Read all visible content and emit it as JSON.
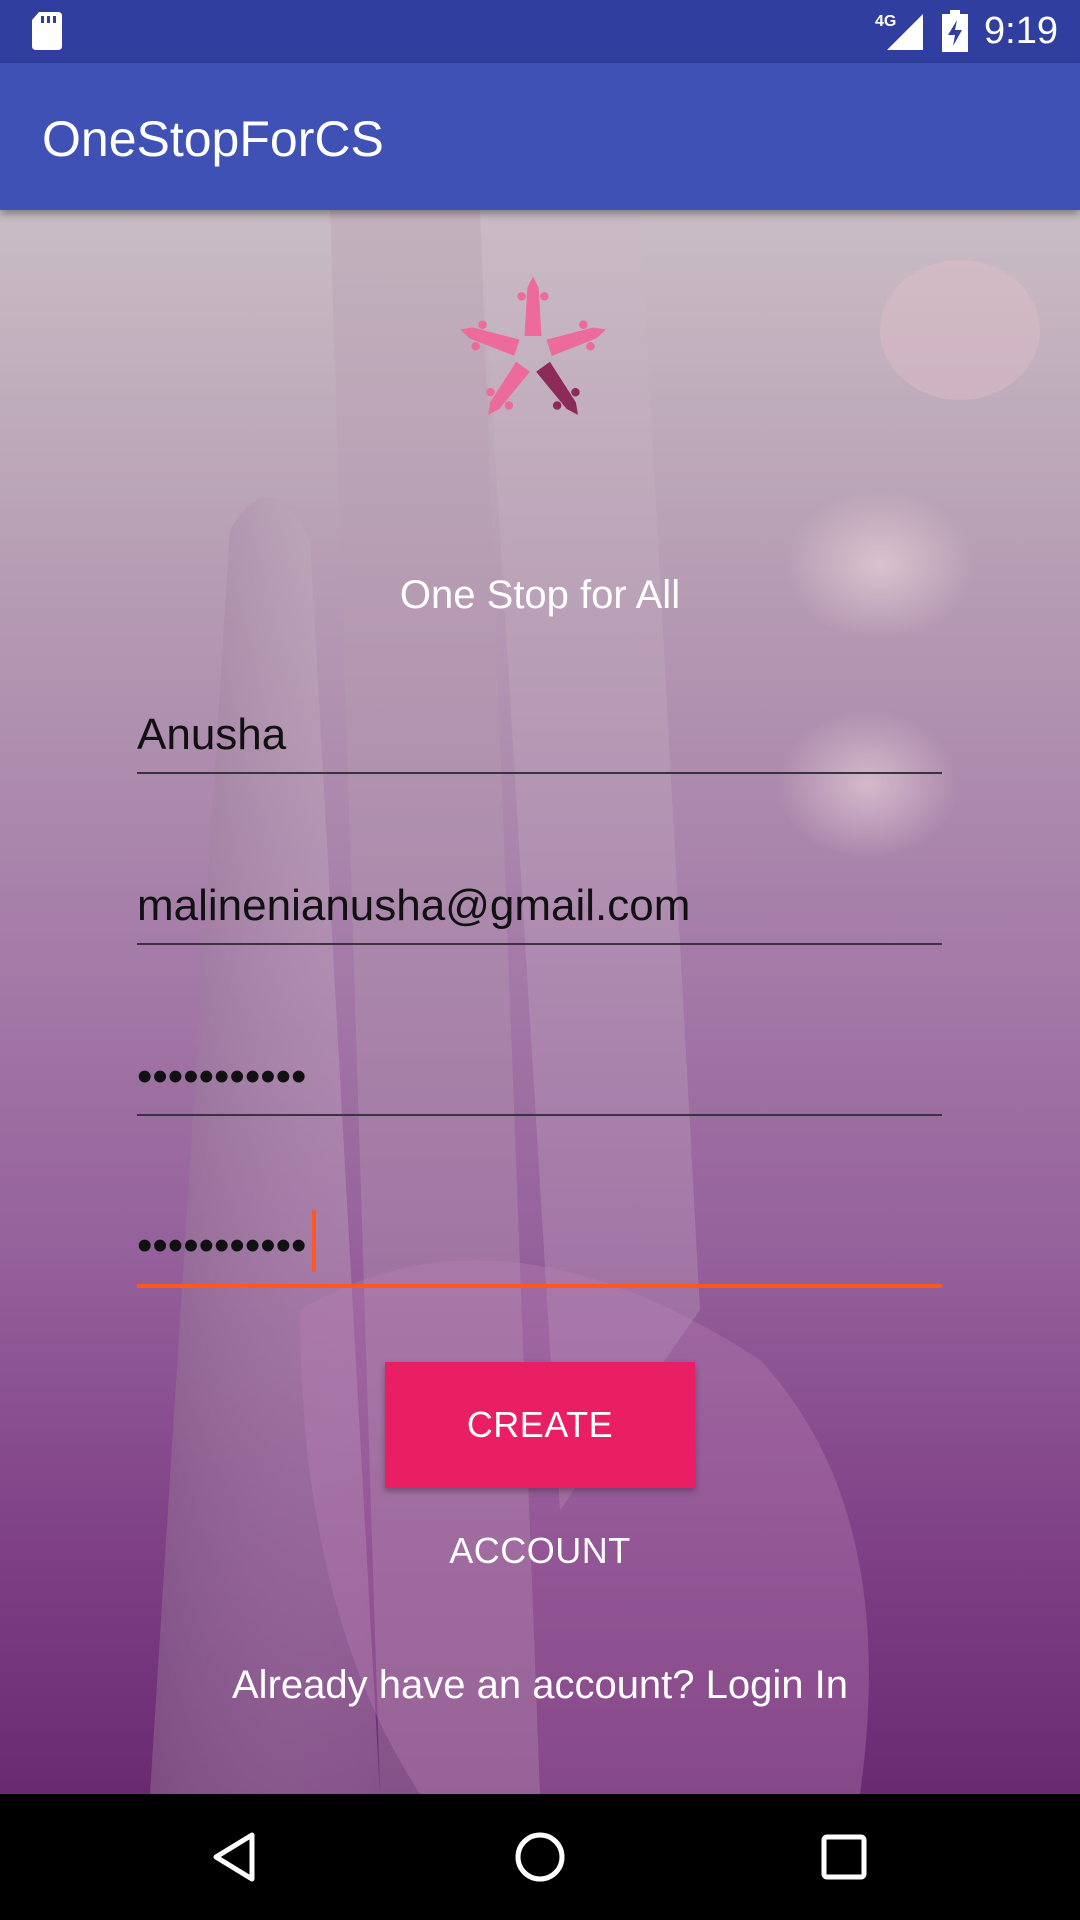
{
  "status_bar": {
    "network": "4G",
    "time": "9:19",
    "icons": [
      "sd-card-icon",
      "signal-4g-icon",
      "battery-charging-icon"
    ]
  },
  "app_bar": {
    "title": "OneStopForCS"
  },
  "main": {
    "tagline": "One Stop for All",
    "fields": {
      "name": "Anusha",
      "email": "malinenianusha@gmail.com",
      "password": "•••••••••••",
      "confirm_password": "•••••••••••"
    },
    "create_button": "CREATE ACCOUNT",
    "login_link": "Already have an account? Login In"
  },
  "nav_bar": {
    "icons": [
      "back-icon",
      "home-icon",
      "recents-icon"
    ]
  },
  "colors": {
    "status_bar": "#303f9f",
    "app_bar": "#3f51b5",
    "accent": "#ff5722",
    "button": "#e91e63"
  }
}
